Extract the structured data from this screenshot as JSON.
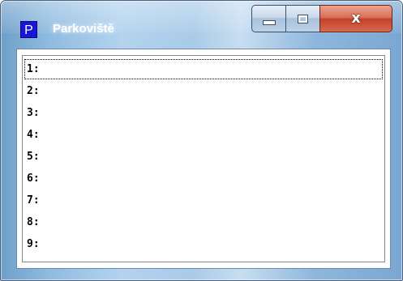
{
  "window": {
    "title": "Parkoviště",
    "icon_letter": "P",
    "icon_color": "#1a16d8",
    "caption_buttons": [
      {
        "name": "minimize",
        "icon": "minimize-icon"
      },
      {
        "name": "maximize",
        "icon": "maximize-icon"
      },
      {
        "name": "close",
        "icon": "close-icon",
        "glyph": "x"
      }
    ]
  },
  "listbox": {
    "items": [
      {
        "label": "1:",
        "focused": true
      },
      {
        "label": "2:",
        "focused": false
      },
      {
        "label": "3:",
        "focused": false
      },
      {
        "label": "4:",
        "focused": false
      },
      {
        "label": "5:",
        "focused": false
      },
      {
        "label": "6:",
        "focused": false
      },
      {
        "label": "7:",
        "focused": false
      },
      {
        "label": "8:",
        "focused": false
      },
      {
        "label": "9:",
        "focused": false
      }
    ]
  }
}
